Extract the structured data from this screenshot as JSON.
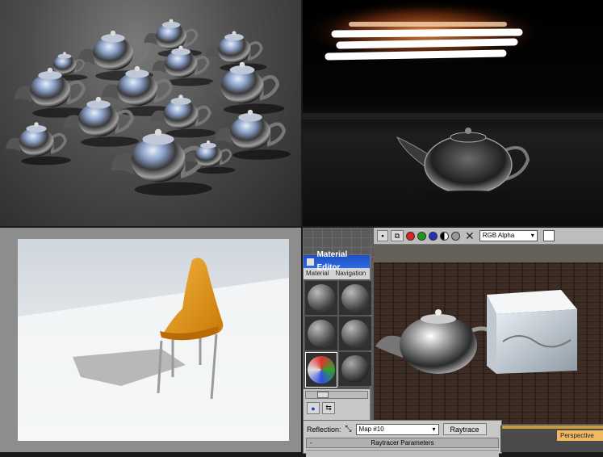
{
  "material_editor": {
    "title": "Material Editor",
    "menu": [
      "Material",
      "Navigation"
    ],
    "reflection_label": "Reflection:",
    "map_select": "Map #10",
    "raytrace_button": "Raytrace",
    "rollout_title": "Raytracer Parameters"
  },
  "render_window": {
    "channel_select": "RGB Alpha"
  },
  "viewport": {
    "label": "Perspective"
  },
  "colors": {
    "titlebar": "#2f6ae0",
    "chair_seat": "#e89a10",
    "viewport_label_bg": "#f0b860"
  }
}
